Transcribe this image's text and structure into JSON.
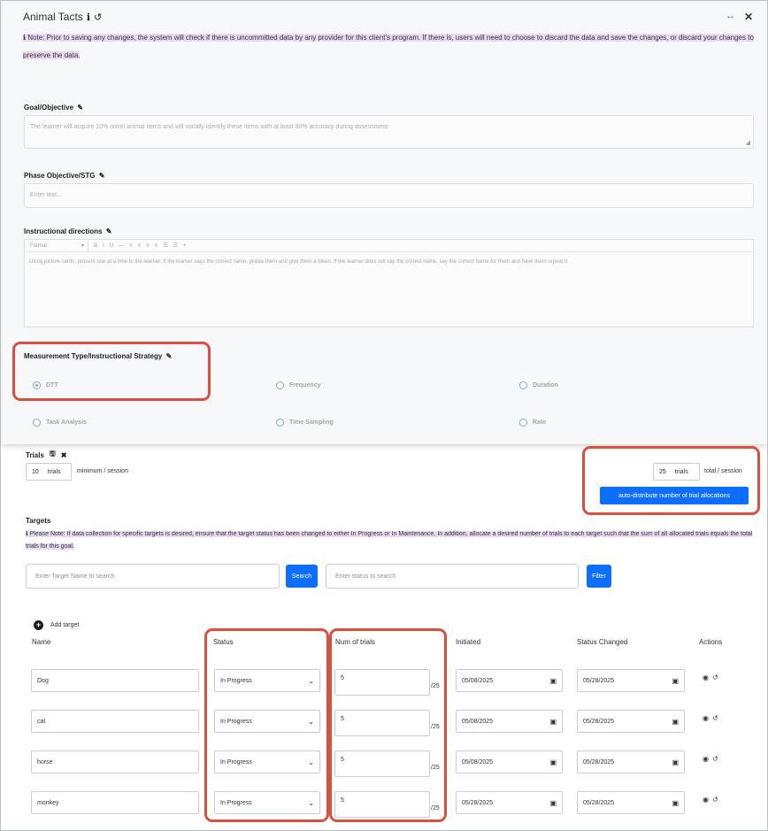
{
  "window": {
    "title": "Animal Tacts",
    "arrows": "↔",
    "close": "✕"
  },
  "note": {
    "icon": "info-icon",
    "text": "Note: Prior to saving any changes, the system will check if there is uncommitted data by any provider for this client's program. If there is, users will need to choose to discard the data and save the changes, or discard your changes to preserve the data."
  },
  "goal": {
    "label": "Goal/Objective",
    "value": "The learner will acquire 10% novel animal items and will vocally identify these items with at least 90% accuracy during assessment"
  },
  "phase": {
    "label": "Phase Objective/STG",
    "placeholder": "Enter text..."
  },
  "instructions": {
    "label": "Instructional directions",
    "toolbar_format": "Format",
    "toolbar_buttons": [
      "B",
      "I",
      "U",
      "—",
      "≡",
      "≡",
      "≡",
      "≡",
      "☰",
      "☰",
      "+"
    ],
    "content": "Using picture cards, present one at a time to the learner. If the learner says the correct name, praise them and give them a token. If the learner does not say the correct name, say the correct name for them and have them repeat it."
  },
  "measurement": {
    "label": "Measurement Type/Instructional Strategy",
    "options": [
      {
        "label": "DTT",
        "checked": true
      },
      {
        "label": "Frequency",
        "checked": false
      },
      {
        "label": "Duration",
        "checked": false
      },
      {
        "label": "Task Analysis",
        "checked": false
      },
      {
        "label": "Time Sampling",
        "checked": false
      },
      {
        "label": "Rate",
        "checked": false
      }
    ]
  },
  "trials": {
    "label": "Trials",
    "min_value": "10",
    "min_suffix": "trials",
    "min_text": "minimum / session",
    "total_value": "25",
    "total_suffix": "trials",
    "total_text": "total / session",
    "auto_button": "auto-distribute number of trial allocations"
  },
  "targets": {
    "label": "Targets",
    "note": "Please Note: If data collection for specific targets is desired, ensure that the target status has been changed to either In Progress or In Maintenance. In addition, allocate a desired number of trials to each target such that the sum of all allocated trials equals the total trials for this goal.",
    "search_placeholder": "Enter Target Name to search",
    "search_button": "Search",
    "status_placeholder": "Enter status to search",
    "filter_button": "Filter",
    "add_target": "Add target"
  },
  "table": {
    "headers": {
      "name": "Name",
      "status": "Status",
      "num_trials": "Num of trials",
      "initiated": "Initiated",
      "status_changed": "Status Changed",
      "actions": "Actions"
    },
    "of_total": "/25",
    "rows": [
      {
        "name": "Dog",
        "status": "In Progress",
        "trials": "5",
        "initiated": "05/08/2025",
        "changed": "05/28/2025"
      },
      {
        "name": "cat",
        "status": "In Progress",
        "trials": "5",
        "initiated": "05/08/2025",
        "changed": "05/28/2025"
      },
      {
        "name": "horse",
        "status": "In Progress",
        "trials": "5",
        "initiated": "05/08/2025",
        "changed": "05/28/2025"
      },
      {
        "name": "monkey",
        "status": "In Progress",
        "trials": "5",
        "initiated": "05/28/2025",
        "changed": "05/28/2025"
      }
    ]
  },
  "colors": {
    "primary": "#0d6efd",
    "highlight_box": "#d9503f",
    "note_highlight": "#ead9f3"
  }
}
